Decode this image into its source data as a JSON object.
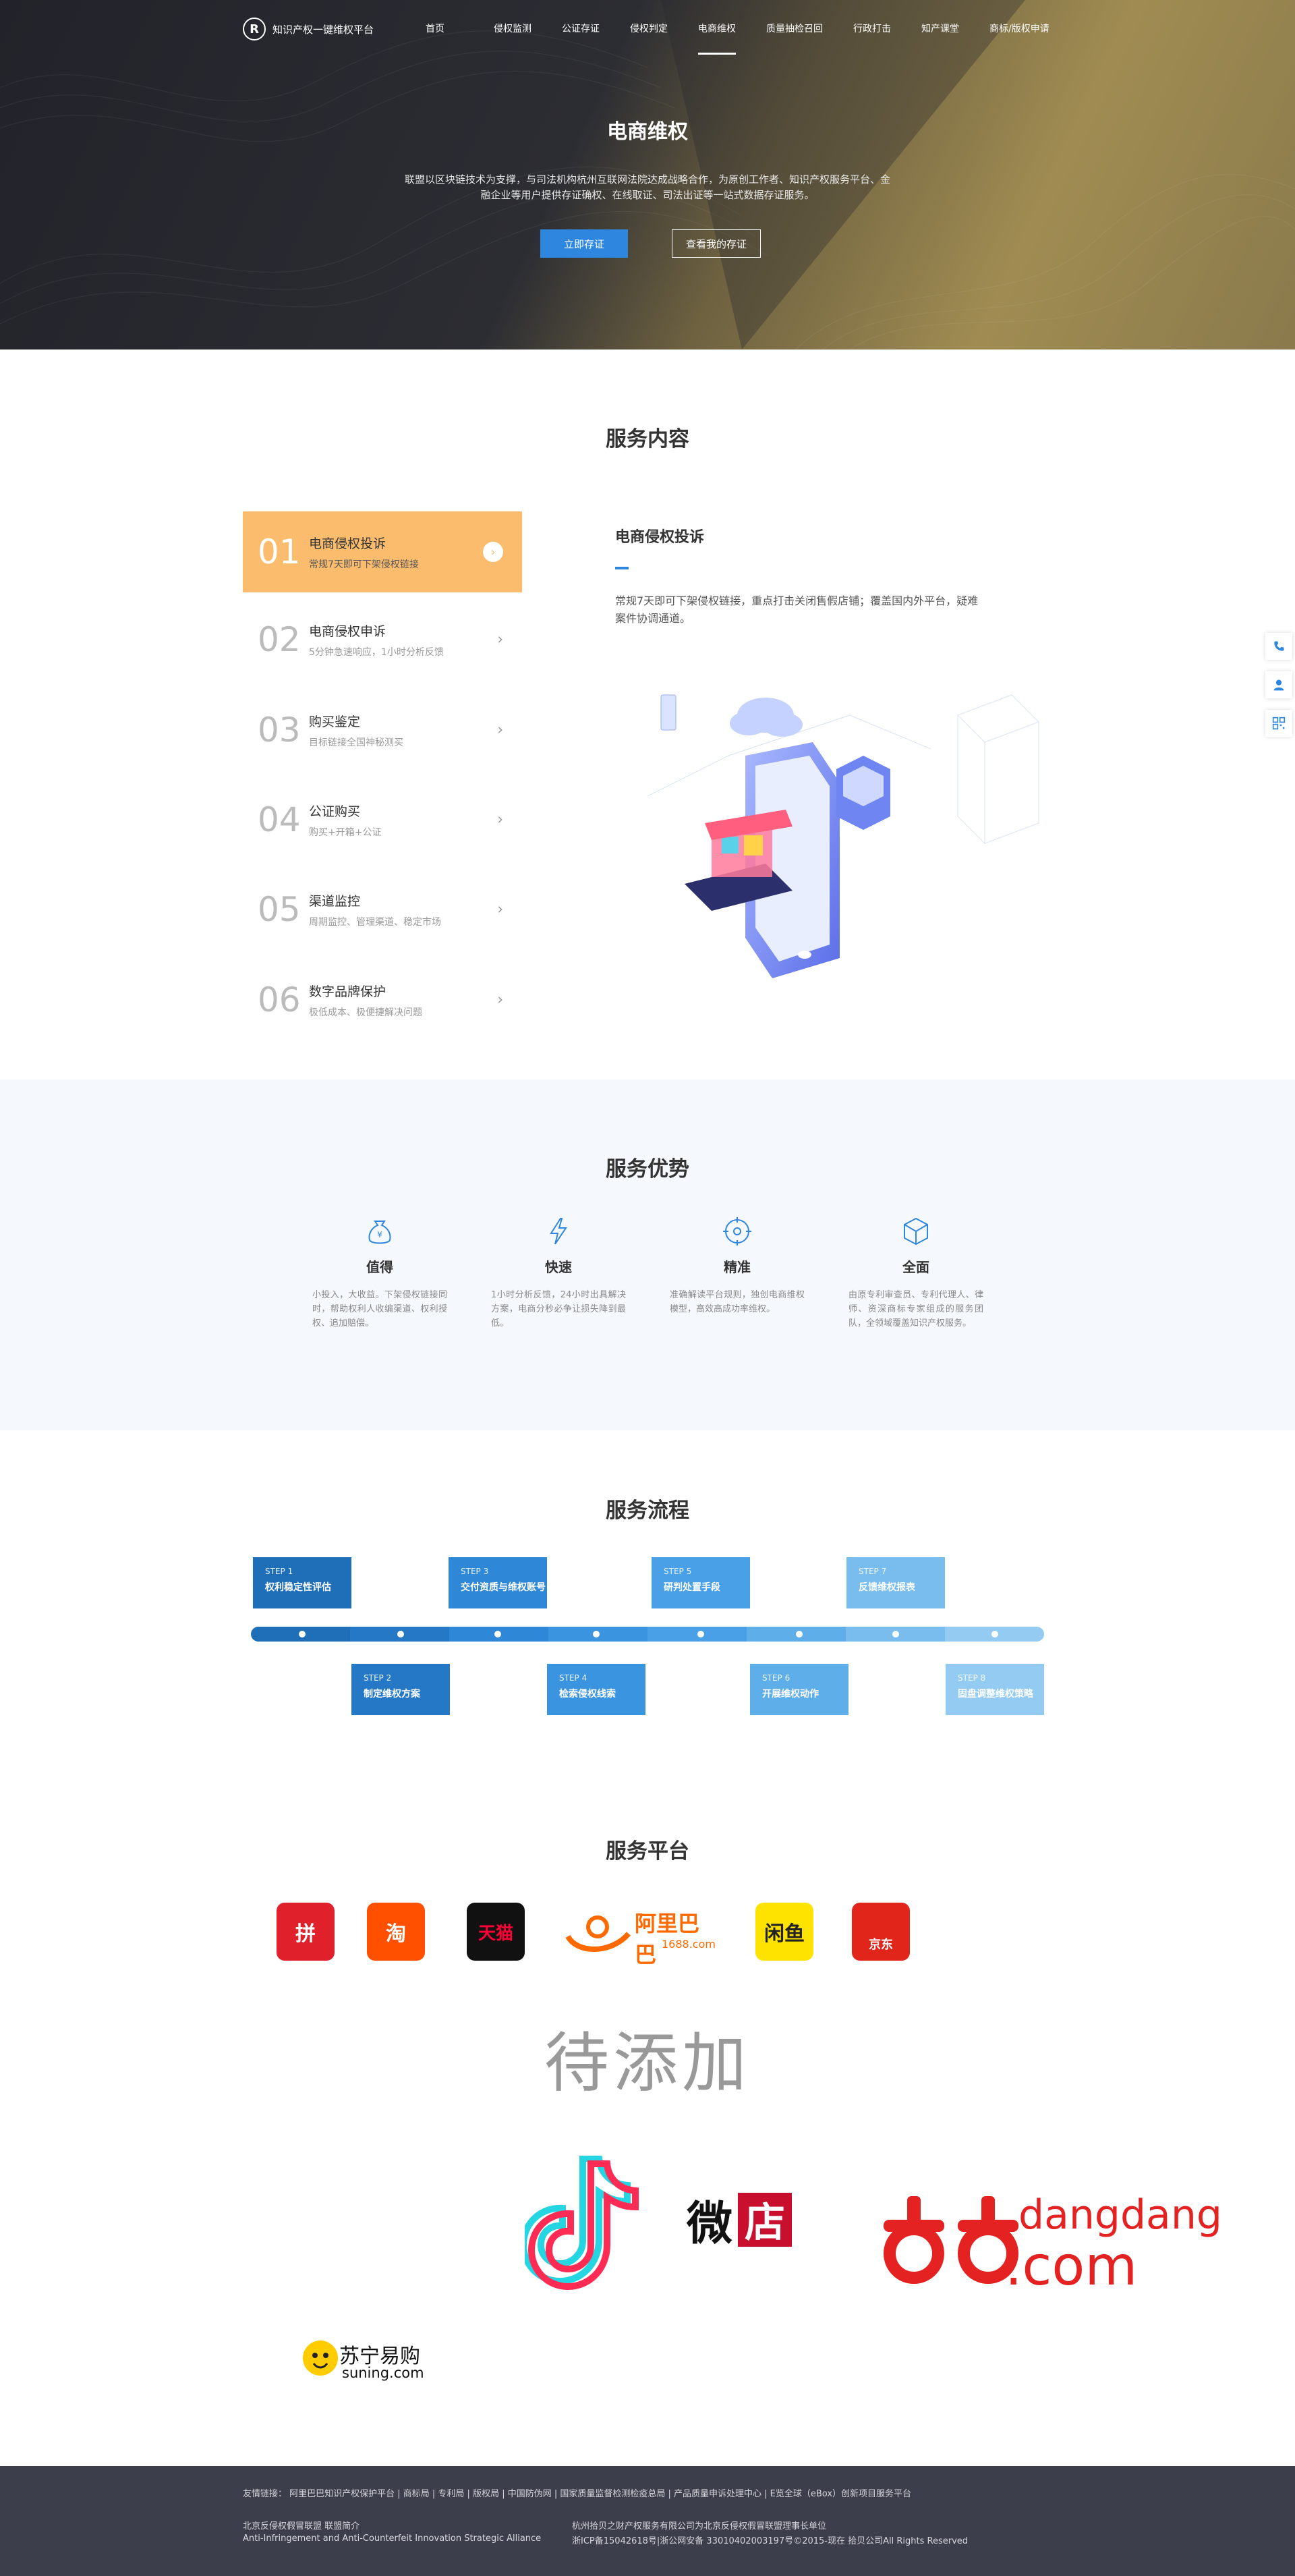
{
  "brand": {
    "logo_mark": "R",
    "name": "知识产权一键维权平台"
  },
  "nav": [
    "首页",
    "侵权监测",
    "公证存证",
    "侵权判定",
    "电商维权",
    "质量抽检召回",
    "行政打击",
    "知产课堂",
    "商标/版权申请"
  ],
  "nav_active": 4,
  "hero": {
    "title": "电商维权",
    "desc": "联盟以区块链技术为支撑，与司法机构杭州互联网法院达成战略合作，为原创工作者、知识产权服务平台、金融企业等用户提供存证确权、在线取证、司法出证等一站式数据存证服务。",
    "btn_primary": "立即存证",
    "btn_secondary": "查看我的存证"
  },
  "services": {
    "title": "服务内容",
    "items": [
      {
        "num": "01",
        "name": "电商侵权投诉",
        "sub": "常规7天即可下架侵权链接"
      },
      {
        "num": "02",
        "name": "电商侵权申诉",
        "sub": "5分钟急速响应，1小时分析反馈"
      },
      {
        "num": "03",
        "name": "购买鉴定",
        "sub": "目标链接全国神秘测买"
      },
      {
        "num": "04",
        "name": "公证购买",
        "sub": "购买+开箱+公证"
      },
      {
        "num": "05",
        "name": "渠道监控",
        "sub": "周期监控、管理渠道、稳定市场"
      },
      {
        "num": "06",
        "name": "数字品牌保护",
        "sub": "极低成本、极便捷解决问题"
      }
    ],
    "active_index": 0,
    "detail": {
      "title": "电商侵权投诉",
      "desc": "常规7天即可下架侵权链接，重点打击关闭售假店铺；覆盖国内外平台，疑难案件协调通道。"
    }
  },
  "advantages": {
    "title": "服务优势",
    "items": [
      {
        "icon": "money-bag-icon",
        "name": "值得",
        "desc": "小投入，大收益。下架侵权链接同时，帮助权利人收编渠道、权利授权、追加赔偿。"
      },
      {
        "icon": "lightning-icon",
        "name": "快速",
        "desc": "1小时分析反馈，24小时出具解决方案，电商分秒必争让损失降到最低。"
      },
      {
        "icon": "target-icon",
        "name": "精准",
        "desc": "准确解读平台规则，独创电商维权模型，高效高成功率维权。"
      },
      {
        "icon": "cube-icon",
        "name": "全面",
        "desc": "由原专利审查员、专利代理人、律师、资深商标专家组成的服务团队，全领域覆盖知识产权服务。"
      }
    ]
  },
  "process": {
    "title": "服务流程",
    "steps": [
      {
        "label": "STEP 1",
        "name": "权利稳定性评估",
        "color": "#1f6fb8"
      },
      {
        "label": "STEP 2",
        "name": "制定维权方案",
        "color": "#2578c6"
      },
      {
        "label": "STEP 3",
        "name": "交付资质与维权账号",
        "color": "#2f87d8"
      },
      {
        "label": "STEP 4",
        "name": "检索侵权线索",
        "color": "#3b94e0"
      },
      {
        "label": "STEP 5",
        "name": "研判处置手段",
        "color": "#49a0e6"
      },
      {
        "label": "STEP 6",
        "name": "开展维权动作",
        "color": "#5eaeea"
      },
      {
        "label": "STEP 7",
        "name": "反馈维权报表",
        "color": "#79bdee"
      },
      {
        "label": "STEP 8",
        "name": "固盘调整维权策略",
        "color": "#93cbf2"
      }
    ]
  },
  "platforms": {
    "title": "服务平台",
    "row1": [
      {
        "icon": "pinduoduo-icon",
        "text": "拼",
        "color": "#e0202b"
      },
      {
        "icon": "taobao-icon",
        "text": "淘",
        "color": "#ff5000"
      },
      {
        "icon": "tmall-icon",
        "text": "天猫",
        "color": "#111111"
      },
      {
        "icon": "alibaba-1688-icon",
        "text": "阿里巴巴",
        "sub": "1688.com",
        "color": "#ff6a00"
      },
      {
        "icon": "xianyu-icon",
        "text": "闲鱼",
        "color": "#ffe300"
      },
      {
        "icon": "jd-icon",
        "text": "京东",
        "color": "#e1251b"
      }
    ],
    "pending": "待添加",
    "weidian": {
      "left": "微",
      "right": "店"
    },
    "dangdang": {
      "line1": "dangdang",
      "line2": ".com"
    },
    "suning": {
      "cn": "苏宁易购",
      "en": "suning.com"
    }
  },
  "footer": {
    "links": "友情链接：  阿里巴巴知识产权保护平台 | 商标局 | 专利局 | 版权局 | 中国防伪网 | 国家质量监督检测检疫总局 | 产品质量申诉处理中心 | E览全球（eBox）创新项目服务平台",
    "alliance_cn": "北京反侵权假冒联盟 联盟简介",
    "alliance_en": "Anti-Infringement and Anti-Counterfeit Innovation Strategic Alliance",
    "company": "杭州拾贝之财产权服务有限公司为北京反侵权假冒联盟理事长单位",
    "icp": "浙ICP备15042618号|浙公网安备 33010402003197号©2015-现在 拾贝公司All Rights Reserved"
  }
}
